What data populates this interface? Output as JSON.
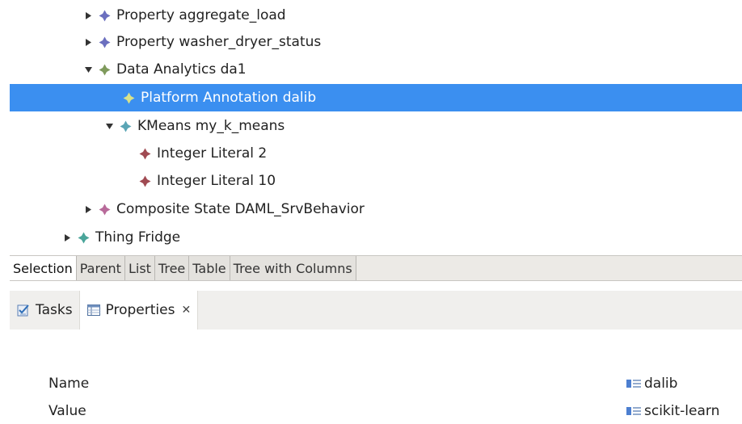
{
  "tree": {
    "items": [
      {
        "label": "Property aggregate_load",
        "state": "collapsed",
        "level": 2,
        "color": "#6b6fbf"
      },
      {
        "label": "Property washer_dryer_status",
        "state": "collapsed",
        "level": 2,
        "color": "#6b6fbf"
      },
      {
        "label": "Data Analytics da1",
        "state": "expanded",
        "level": 2,
        "color": "#7f9a5c"
      },
      {
        "label": "Platform Annotation dalib",
        "state": "leaf",
        "level": 3,
        "color": "#c9d67a",
        "selected": true
      },
      {
        "label": "KMeans my_k_means",
        "state": "expanded",
        "level": 3,
        "color": "#5aa5b5"
      },
      {
        "label": "Integer Literal 2",
        "state": "leaf",
        "level": 4,
        "color": "#a04a52"
      },
      {
        "label": "Integer Literal 10",
        "state": "leaf",
        "level": 4,
        "color": "#a04a52"
      },
      {
        "label": "Composite State DAML_SrvBehavior",
        "state": "collapsed",
        "level": 2,
        "color": "#b86a9a"
      },
      {
        "label": "Thing Fridge",
        "state": "collapsed",
        "level": 1,
        "color": "#4aa59a"
      }
    ]
  },
  "editor_tabs": [
    {
      "label": "Selection",
      "active": true
    },
    {
      "label": "Parent",
      "active": false
    },
    {
      "label": "List",
      "active": false
    },
    {
      "label": "Tree",
      "active": false
    },
    {
      "label": "Table",
      "active": false
    },
    {
      "label": "Tree with Columns",
      "active": false
    }
  ],
  "view_tabs": {
    "tasks": {
      "label": "Tasks",
      "icon": "tasks-icon"
    },
    "properties": {
      "label": "Properties",
      "icon": "properties-icon",
      "close": "✕"
    }
  },
  "properties": {
    "rows": [
      {
        "label": "Name",
        "value": "dalib"
      },
      {
        "label": "Value",
        "value": "scikit-learn"
      }
    ]
  },
  "colors": {
    "selection": "#3b8ff0"
  }
}
